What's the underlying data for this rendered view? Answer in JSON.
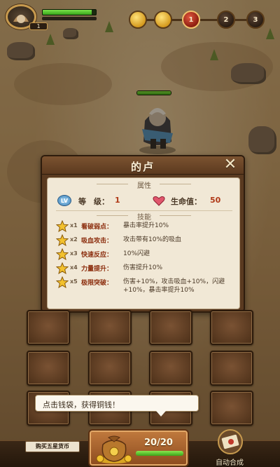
{
  "hud": {
    "player_level": "1",
    "stage_nodes": [
      "",
      "",
      "1",
      "2",
      "3"
    ]
  },
  "hero_panel": {
    "title": "的卢",
    "close_symbol": "✕",
    "attributes_heading": "属性",
    "level_badge": "LV",
    "level_label": "等　级：",
    "level_value": "1",
    "hp_label": "生命值：",
    "hp_value": "50",
    "skills_heading": "技能",
    "skills": [
      {
        "mult": "x1",
        "name": "看破弱点：",
        "desc": "暴击率提升10%"
      },
      {
        "mult": "x2",
        "name": "吸血攻击：",
        "desc": "攻击带有10%的吸血"
      },
      {
        "mult": "x3",
        "name": "快速反应：",
        "desc": "10%闪避"
      },
      {
        "mult": "x4",
        "name": "力量提升：",
        "desc": "伤害提升10%"
      },
      {
        "mult": "x5",
        "name": "极限突破：",
        "desc": "伤害+10%，攻击吸血+10%，闪避+10%，暴击率提升10%"
      }
    ]
  },
  "tooltip": {
    "text": "点击钱袋，获得铜钱！"
  },
  "bottom": {
    "buy_button": "购买五星货币",
    "bag_count": "20/20",
    "bag_fill_percent": 100,
    "auto_merge_label": "自动合成"
  },
  "colors": {
    "panel_brown": "#5a3a20",
    "parchment": "#f1e8d6",
    "skill_name": "#8b2c0c",
    "stat_value": "#b03a18",
    "hp_green": "#3aa81b"
  }
}
